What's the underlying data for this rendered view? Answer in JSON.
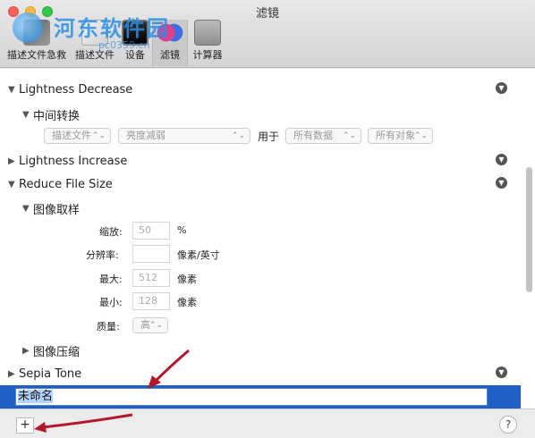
{
  "window": {
    "title": "滤镜"
  },
  "toolbar": {
    "items": [
      {
        "label": "描述文件急救",
        "icon": "summary-icon"
      },
      {
        "label": "描述文件",
        "icon": "profile-icon"
      },
      {
        "label": "设备",
        "icon": "device-icon"
      },
      {
        "label": "滤镜",
        "icon": "filter-icon",
        "active": true
      },
      {
        "label": "计算器",
        "icon": "calculator-icon"
      }
    ]
  },
  "watermark": {
    "text": "河东软件园",
    "url": "pc0359.cn"
  },
  "filters": [
    {
      "name": "Lightness Decrease",
      "expanded": true
    },
    {
      "name": "Lightness Increase",
      "expanded": false
    },
    {
      "name": "Reduce File Size",
      "expanded": true
    },
    {
      "name": "Sepia Tone",
      "expanded": false
    }
  ],
  "lightness_decrease": {
    "sub_title": "中间转换",
    "popup1": "描述文件",
    "popup2": "亮度减弱",
    "for_label": "用于",
    "popup3": "所有数据",
    "popup4": "所有对象"
  },
  "reduce_file_size": {
    "sub1_title": "图像取样",
    "scale_label": "缩放:",
    "scale_value": "50",
    "scale_unit": "%",
    "resolution_label": "分辨率:",
    "resolution_value": "",
    "resolution_unit": "像素/英寸",
    "max_label": "最大:",
    "max_value": "512",
    "max_unit": "像素",
    "min_label": "最小:",
    "min_value": "128",
    "min_unit": "像素",
    "quality_label": "质量:",
    "quality_value": "高",
    "sub2_title": "图像压缩"
  },
  "new_filter": {
    "name": "未命名"
  },
  "bottom": {
    "add_label": "+",
    "help_label": "?"
  },
  "colors": {
    "selection": "#1f5fc4",
    "annotation_arrow": "#b3182a"
  }
}
